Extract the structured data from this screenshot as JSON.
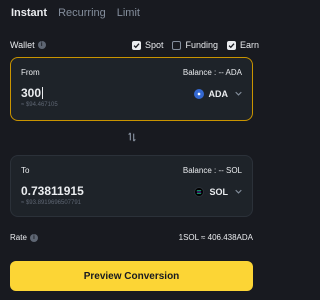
{
  "tabs": [
    {
      "label": "Instant",
      "active": true
    },
    {
      "label": "Recurring",
      "active": false
    },
    {
      "label": "Limit",
      "active": false
    }
  ],
  "wallet": {
    "label": "Wallet",
    "options": [
      {
        "label": "Spot",
        "checked": true
      },
      {
        "label": "Funding",
        "checked": false
      },
      {
        "label": "Earn",
        "checked": true
      }
    ]
  },
  "from": {
    "label": "From",
    "balance": "Balance : -- ADA",
    "amount": "300",
    "usd_value": "≈ $94.467105",
    "coin": "ADA"
  },
  "to": {
    "label": "To",
    "balance": "Balance : -- SOL",
    "amount": "0.73811915",
    "usd_value": "≈ $93.8919696507791",
    "coin": "SOL"
  },
  "rate": {
    "label": "Rate",
    "value": "1SOL ≈ 406.438ADA"
  },
  "preview_button": "Preview Conversion",
  "colors": {
    "accent": "#fcd535",
    "background": "#181a20",
    "card": "#1e2329",
    "active_border": "#c99400",
    "ada_logo": "#3468d1",
    "sol_logo": "#000000"
  },
  "icons": {
    "info": "info-icon",
    "swap": "swap-arrows-icon",
    "chevron": "chevron-down-icon",
    "check": "check-icon"
  }
}
